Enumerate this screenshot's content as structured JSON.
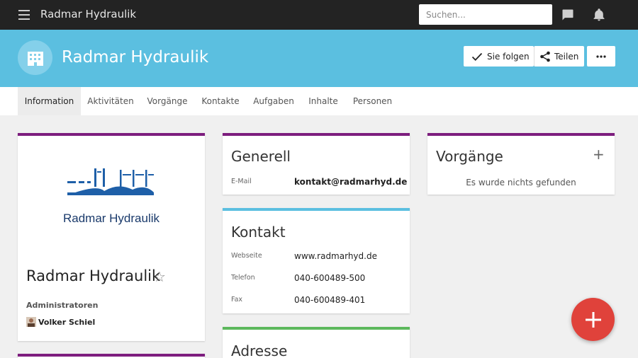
{
  "app": {
    "title": "Radmar Hydraulik"
  },
  "search": {
    "placeholder": "Suchen..."
  },
  "header": {
    "title": "Radmar Hydraulik",
    "follow_label": "Sie folgen",
    "share_label": "Teilen"
  },
  "tabs": [
    {
      "label": "Information",
      "active": true
    },
    {
      "label": "Aktivitäten"
    },
    {
      "label": "Vorgänge"
    },
    {
      "label": "Kontakte"
    },
    {
      "label": "Aufgaben"
    },
    {
      "label": "Inhalte"
    },
    {
      "label": "Personen"
    }
  ],
  "profile": {
    "logo_text": "Radmar Hydraulik",
    "name": "Radmar Hydraulik",
    "admins_heading": "Administratoren",
    "admin_name": "Volker Schiel"
  },
  "generell": {
    "title": "Generell",
    "email_label": "E-Mail",
    "email_value": "kontakt@radmarhyd.de"
  },
  "kontakt": {
    "title": "Kontakt",
    "website_label": "Webseite",
    "website_value": "www.radmarhyd.de",
    "phone_label": "Telefon",
    "phone_value": "040-600489-500",
    "fax_label": "Fax",
    "fax_value": "040-600489-401"
  },
  "adresse": {
    "title": "Adresse"
  },
  "vorgaenge": {
    "title": "Vorgänge",
    "empty_text": "Es wurde nichts gefunden"
  },
  "colors": {
    "topbar": "#232323",
    "header": "#5bbfe0",
    "accent_purple": "#7d1d7e",
    "accent_green": "#5cb85c",
    "fab": "#e0423b",
    "logo_blue": "#1e5fa8",
    "logo_navy": "#1a3a6b"
  },
  "icons": {
    "menu": "menu-icon",
    "chat": "chat-icon",
    "notifications": "bell-icon",
    "company": "building-icon",
    "follow": "check-icon",
    "share": "share-icon",
    "more": "more-icon",
    "favorite": "star-icon",
    "add": "plus-icon"
  }
}
